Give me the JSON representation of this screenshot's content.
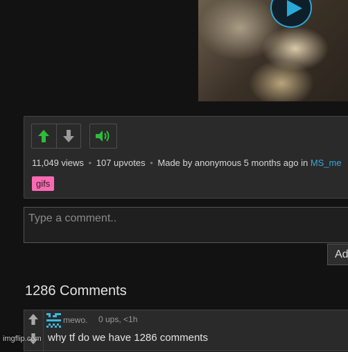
{
  "post": {
    "stats": {
      "views": "11,049 views",
      "sep1": "•",
      "upvotes": "107 upvotes",
      "sep2": "•",
      "made_by": "Made by anonymous 5 months ago in",
      "stream": "MS_me"
    },
    "tag": "gifs"
  },
  "comment_box": {
    "placeholder": "Type a comment..",
    "value": "",
    "add_button": "Ad"
  },
  "comments": {
    "header": "1286 Comments",
    "items": [
      {
        "username": "mewo.",
        "info": "0 ups, <1h",
        "text": "why tf do we have 1286 comments"
      }
    ]
  },
  "watermark": "imgflip.com",
  "colors": {
    "background": "#121212",
    "panel": "#2a2a2a",
    "upvote_green": "#2ebd3a",
    "link_blue": "#35a9dc",
    "tag_pink": "#ff69b4",
    "play_accent": "#2aa8d8"
  },
  "icons": [
    "play-icon",
    "upvote-arrow-icon",
    "downvote-arrow-icon",
    "speaker-icon",
    "avatar-pixel-icon"
  ]
}
